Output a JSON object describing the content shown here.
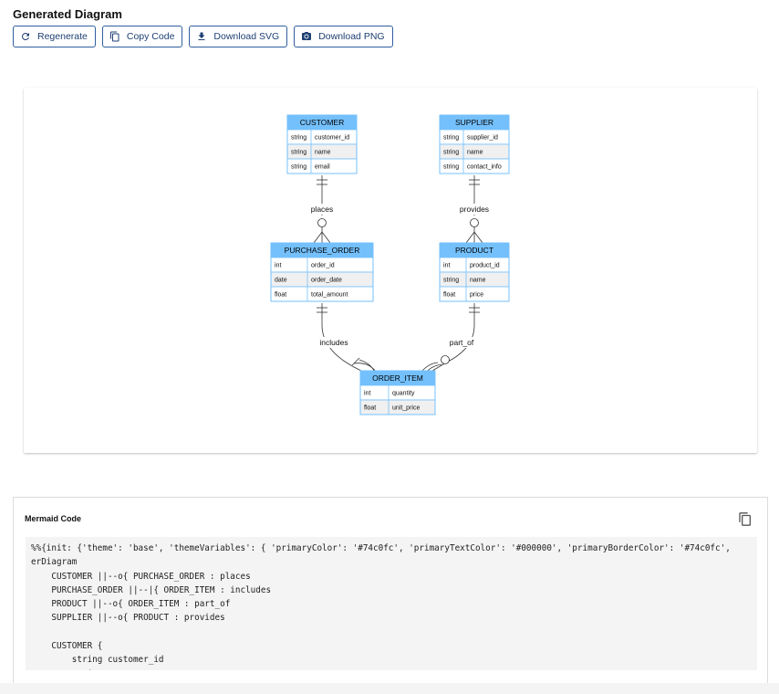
{
  "header": {
    "title": "Generated Diagram"
  },
  "toolbar": {
    "regenerate_label": "Regenerate",
    "copy_code_label": "Copy Code",
    "download_svg_label": "Download SVG",
    "download_png_label": "Download PNG"
  },
  "colors": {
    "primary": "#74c0fc",
    "row_even": "#f0f0f0",
    "row_odd": "#ffffff",
    "button_border": "#2f5f9e"
  },
  "diagram": {
    "entities": {
      "customer": {
        "title": "CUSTOMER",
        "rows": [
          [
            "string",
            "customer_id"
          ],
          [
            "string",
            "name"
          ],
          [
            "string",
            "email"
          ]
        ]
      },
      "supplier": {
        "title": "SUPPLIER",
        "rows": [
          [
            "string",
            "supplier_id"
          ],
          [
            "string",
            "name"
          ],
          [
            "string",
            "contact_info"
          ]
        ]
      },
      "purchase_order": {
        "title": "PURCHASE_ORDER",
        "rows": [
          [
            "int",
            "order_id"
          ],
          [
            "date",
            "order_date"
          ],
          [
            "float",
            "total_amount"
          ]
        ]
      },
      "product": {
        "title": "PRODUCT",
        "rows": [
          [
            "int",
            "product_id"
          ],
          [
            "string",
            "name"
          ],
          [
            "float",
            "price"
          ]
        ]
      },
      "order_item": {
        "title": "ORDER_ITEM",
        "rows": [
          [
            "int",
            "quantity"
          ],
          [
            "float",
            "unit_price"
          ]
        ]
      }
    },
    "relationships": {
      "places": "places",
      "provides": "provides",
      "includes": "includes",
      "part_of": "part_of"
    }
  },
  "code_panel": {
    "title": "Mermaid Code",
    "lines": [
      "%%{init: {'theme': 'base', 'themeVariables': { 'primaryColor': '#74c0fc', 'primaryTextColor': '#000000', 'primaryBorderColor': '#74c0fc',",
      "erDiagram",
      "    CUSTOMER ||--o{ PURCHASE_ORDER : places",
      "    PURCHASE_ORDER ||--|{ ORDER_ITEM : includes",
      "    PRODUCT ||--o{ ORDER_ITEM : part_of",
      "    SUPPLIER ||--o{ PRODUCT : provides",
      "",
      "    CUSTOMER {",
      "        string customer_id",
      "        string name"
    ]
  }
}
